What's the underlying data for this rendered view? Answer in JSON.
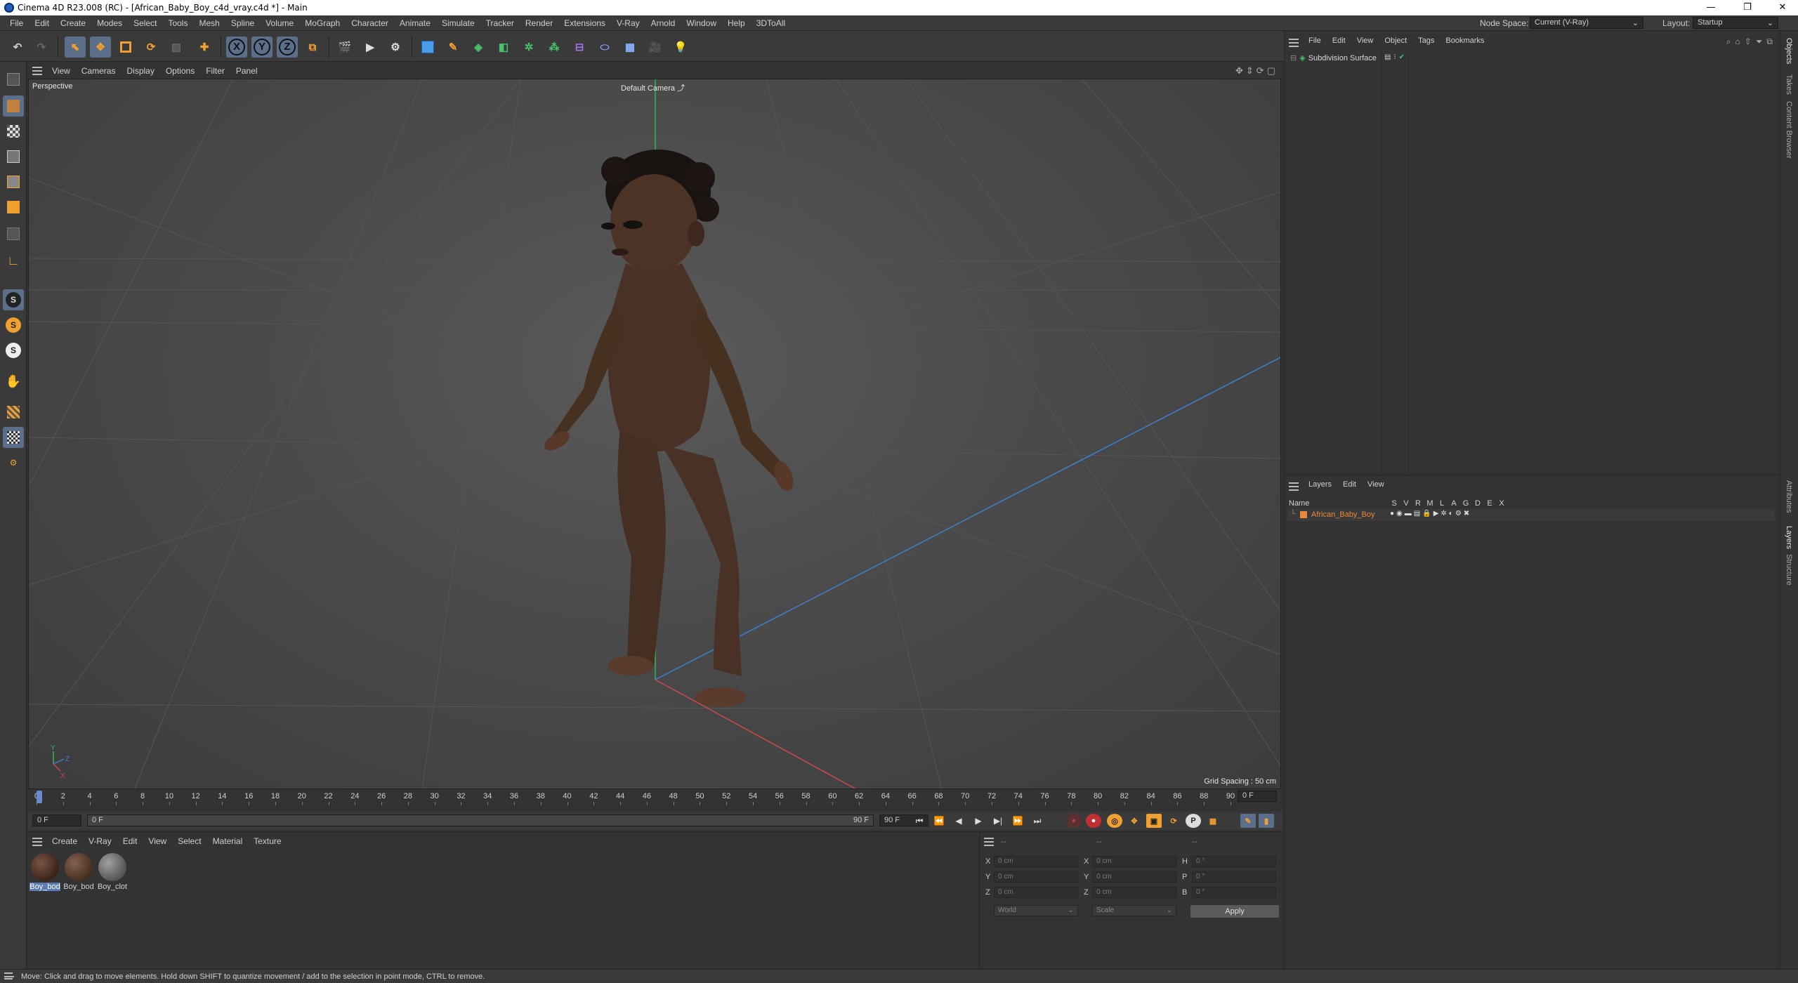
{
  "window": {
    "title": "Cinema 4D R23.008 (RC) - [African_Baby_Boy_c4d_vray.c4d *] - Main",
    "minimize": "—",
    "maximize": "❐",
    "close": "✕"
  },
  "menubar": {
    "items": [
      "File",
      "Edit",
      "Create",
      "Modes",
      "Select",
      "Tools",
      "Mesh",
      "Spline",
      "Volume",
      "MoGraph",
      "Character",
      "Animate",
      "Simulate",
      "Tracker",
      "Render",
      "Extensions",
      "V-Ray",
      "Arnold",
      "Window",
      "Help",
      "3DToAll"
    ],
    "node_space_label": "Node Space:",
    "node_space_value": "Current (V-Ray)",
    "layout_label": "Layout:",
    "layout_value": "Startup"
  },
  "toolbar": {
    "axis_x": "X",
    "axis_y": "Y",
    "axis_z": "Z"
  },
  "viewport": {
    "menu": [
      "View",
      "Cameras",
      "Display",
      "Options",
      "Filter",
      "Panel"
    ],
    "label": "Perspective",
    "camera": "Default Camera",
    "grid_spacing": "Grid Spacing : 50 cm",
    "axis_labels": {
      "y": "Y",
      "z": "Z",
      "x": "X"
    }
  },
  "timeline": {
    "ticks": [
      "0",
      "2",
      "4",
      "6",
      "8",
      "10",
      "12",
      "14",
      "16",
      "18",
      "20",
      "22",
      "24",
      "26",
      "28",
      "30",
      "32",
      "34",
      "36",
      "38",
      "40",
      "42",
      "44",
      "46",
      "48",
      "50",
      "52",
      "54",
      "56",
      "58",
      "60",
      "62",
      "64",
      "66",
      "68",
      "70",
      "72",
      "74",
      "76",
      "78",
      "80",
      "82",
      "84",
      "86",
      "88",
      "90"
    ],
    "current_frame": "0 F",
    "start_field": "0 F",
    "range_start": "0 F",
    "range_end": "90 F",
    "end_field": "90 F"
  },
  "materials": {
    "menu": [
      "Create",
      "V-Ray",
      "Edit",
      "View",
      "Select",
      "Material",
      "Texture"
    ],
    "items": [
      {
        "name": "Boy_bod",
        "color": "#4a3024"
      },
      {
        "name": "Boy_bod",
        "color": "#55382a"
      },
      {
        "name": "Boy_clot",
        "color": "#777777"
      }
    ]
  },
  "coordinates": {
    "header_a": "--",
    "header_b": "--",
    "header_c": "--",
    "rows": [
      {
        "l1": "X",
        "v1": "0 cm",
        "l2": "X",
        "v2": "0 cm",
        "l3": "H",
        "v3": "0 °"
      },
      {
        "l1": "Y",
        "v1": "0 cm",
        "l2": "Y",
        "v2": "0 cm",
        "l3": "P",
        "v3": "0 °"
      },
      {
        "l1": "Z",
        "v1": "0 cm",
        "l2": "Z",
        "v2": "0 cm",
        "l3": "B",
        "v3": "0 °"
      }
    ],
    "mode_world": "World",
    "mode_scale": "Scale",
    "apply": "Apply"
  },
  "objects": {
    "menu": [
      "File",
      "Edit",
      "View",
      "Object",
      "Tags",
      "Bookmarks"
    ],
    "item": "Subdivision Surface"
  },
  "layers": {
    "menu": [
      "Layers",
      "Edit",
      "View"
    ],
    "columns": [
      "Name",
      "S",
      "V",
      "R",
      "M",
      "L",
      "A",
      "G",
      "D",
      "E",
      "X"
    ],
    "row_name": "African_Baby_Boy",
    "row_color": "#e8893a"
  },
  "right_tabs": [
    "Objects",
    "Takes",
    "Content Browser",
    "Attributes",
    "Layers",
    "Structure"
  ],
  "status": {
    "text": "Move: Click and drag to move elements. Hold down SHIFT to quantize movement / add to the selection in point mode, CTRL to remove."
  },
  "colors": {
    "accent": "#5b7bb5",
    "layer_orange": "#e8893a",
    "skin": "#5a3a2a"
  }
}
